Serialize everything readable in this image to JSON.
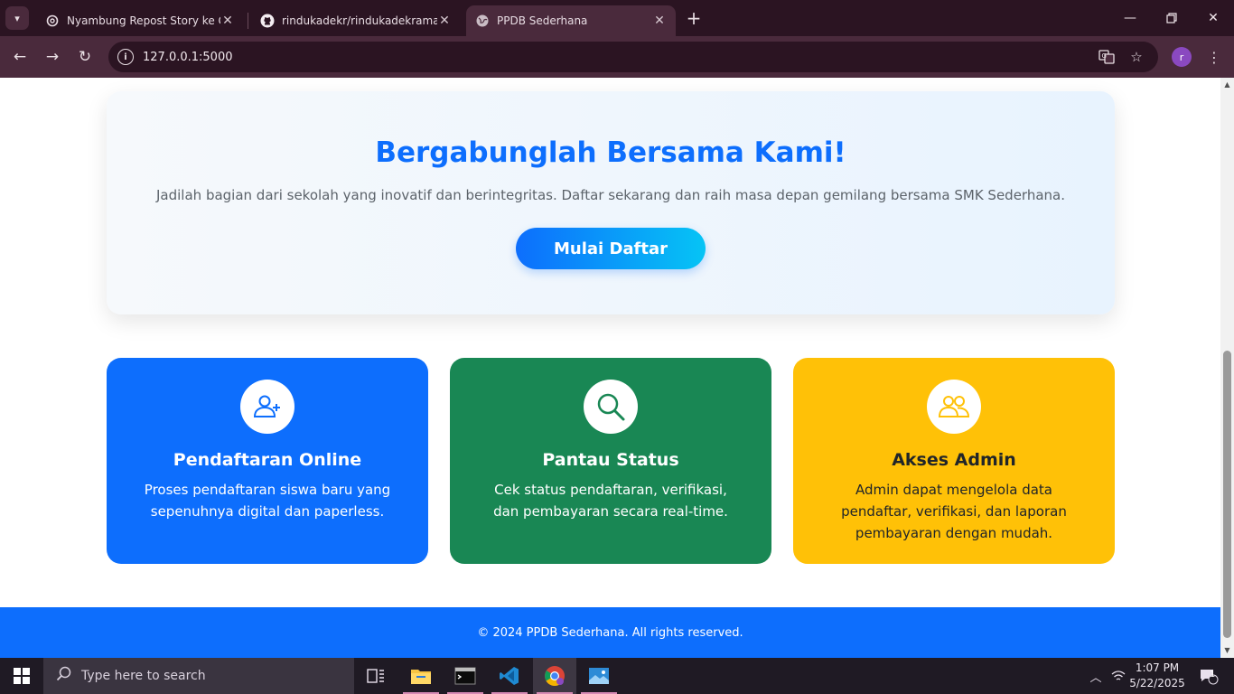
{
  "browser": {
    "tabs": [
      {
        "title": "Nyambung Repost Story ke GitH",
        "icon": "openai-icon"
      },
      {
        "title": "rindukadekr/rindukadekramadh",
        "icon": "github-icon"
      },
      {
        "title": "PPDB Sederhana",
        "icon": "globe-icon",
        "active": true
      }
    ],
    "url": "127.0.0.1:5000",
    "profile_initial": "r"
  },
  "hero": {
    "title": "Bergabunglah Bersama Kami!",
    "subtitle": "Jadilah bagian dari sekolah yang inovatif dan berintegritas. Daftar sekarang dan raih masa depan gemilang bersama SMK Sederhana.",
    "cta_label": "Mulai Daftar"
  },
  "features": [
    {
      "title": "Pendaftaran Online",
      "description": "Proses pendaftaran siswa baru yang sepenuhnya digital dan paperless.",
      "color": "#0d6efd",
      "icon": "user-plus-icon"
    },
    {
      "title": "Pantau Status",
      "description": "Cek status pendaftaran, verifikasi, dan pembayaran secara real-time.",
      "color": "#198754",
      "icon": "search-icon"
    },
    {
      "title": "Akses Admin",
      "description": "Admin dapat mengelola data pendaftar, verifikasi, dan laporan pembayaran dengan mudah.",
      "color": "#ffc107",
      "icon": "users-icon"
    }
  ],
  "footer": {
    "text": "© 2024 PPDB Sederhana. All rights reserved."
  },
  "taskbar": {
    "search_placeholder": "Type here to search",
    "time": "1:07 PM",
    "date": "5/22/2025",
    "notification_count": "1"
  }
}
